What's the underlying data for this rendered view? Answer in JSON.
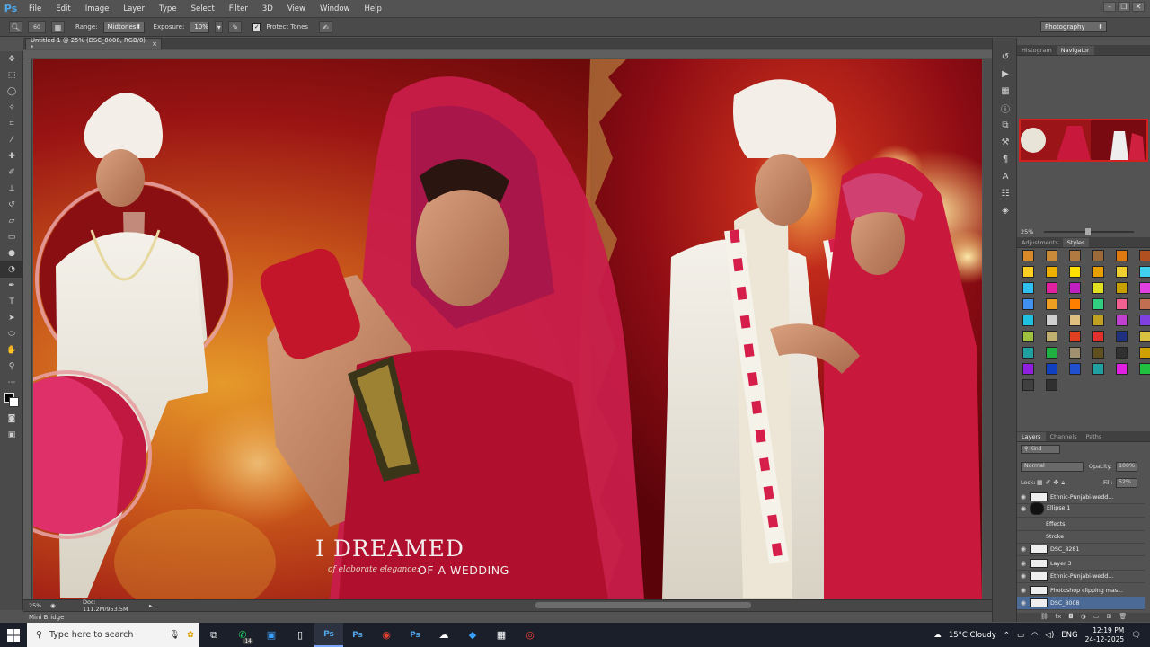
{
  "app": {
    "logo": "Ps",
    "menu": [
      "File",
      "Edit",
      "Image",
      "Layer",
      "Type",
      "Select",
      "Filter",
      "3D",
      "View",
      "Window",
      "Help"
    ],
    "window_controls": [
      "minimize-icon",
      "restore-icon",
      "close-icon"
    ]
  },
  "options": {
    "range_label": "Range:",
    "range_value": "Midtones",
    "exposure_label": "Exposure:",
    "exposure_value": "10%",
    "protect_label": "Protect Tones",
    "brush_size": "60"
  },
  "workspace": "Photography",
  "document": {
    "tab_title": "Untitled-1 @ 25% (DSC_8008, RGB/8) *",
    "close": "×",
    "zoom": "25%",
    "doc_info": "Doc: 111.2M/953.5M"
  },
  "canvas_text": {
    "headline": "I DREAMED",
    "script_line": "of elaborate elegance;",
    "subline": "OF A WEDDING"
  },
  "mini_bridge": "Mini Bridge",
  "panels": {
    "top_tabs": [
      "Histogram",
      "Navigator"
    ],
    "nav_zoom": "25%",
    "mid_tabs": [
      "Adjustments",
      "Styles"
    ],
    "styles": [
      "#d88a2a",
      "#c98a3a",
      "#b07a40",
      "#9a6a3a",
      "#e07a10",
      "#b05020",
      "#ffd020",
      "#f0b000",
      "#ffe000",
      "#e8a000",
      "#f0d030",
      "#40d0f0",
      "#30c0f0",
      "#e020a0",
      "#c020c0",
      "#e0e020",
      "#c8a000",
      "#e040e0",
      "#4090f0",
      "#f0a020",
      "#ff8000",
      "#30d080",
      "#f06090",
      "#c07050",
      "#20c0e0",
      "#d0d0d0",
      "#e0c080",
      "#c0a020",
      "#c040d0",
      "#8040e0",
      "#a0c040",
      "#c0b070",
      "#e04020",
      "#e03030",
      "#203080",
      "#d8c040",
      "#20a0a0",
      "#20b040",
      "#a09070",
      "#605020",
      "#303030",
      "#d0a000",
      "#9020e0",
      "#1040c0",
      "#2050d0",
      "#20a0a0",
      "#e020e0",
      "#20c040",
      "#404040",
      "#303030"
    ],
    "layers_tabs": [
      "Layers",
      "Channels",
      "Paths"
    ],
    "kind": "Kind",
    "blend": "Normal",
    "opacity_label": "Opacity:",
    "opacity": "100%",
    "lock_label": "Lock:",
    "fill_label": "Fill:",
    "fill": "52%",
    "layers": [
      {
        "name": "Ethnic-Punjabi-wedd..."
      },
      {
        "name": "Ellipse 1"
      },
      {
        "name": "Effects"
      },
      {
        "name": "Stroke"
      },
      {
        "name": "DSC_8281"
      },
      {
        "name": "Layer 3"
      },
      {
        "name": "Ethnic-Punjabi-wedd..."
      },
      {
        "name": "Photoshop clipping mas..."
      },
      {
        "name": "DSC_8008"
      }
    ]
  },
  "taskbar": {
    "search_placeholder": "Type here to search",
    "badge": "14",
    "weather": "15°C Cloudy",
    "lang": "ENG",
    "time": "12:19 PM",
    "date": "24-12-2025"
  }
}
